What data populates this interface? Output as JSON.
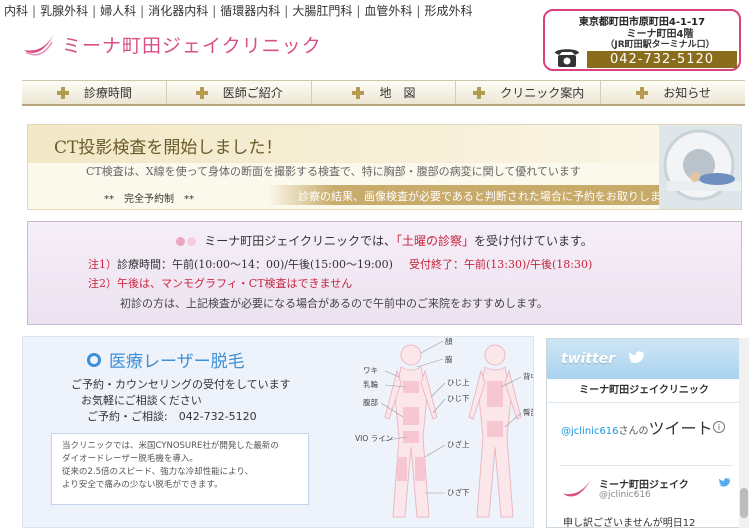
{
  "header": {
    "departments": [
      "内科",
      "乳腺外科",
      "婦人科",
      "消化器内科",
      "循環器内科",
      "大腸肛門科",
      "血管外科",
      "形成外科"
    ],
    "clinic_name": "ミーナ町田ジェイクリニック",
    "address_line1": "東京都町田市原町田4-1-17",
    "address_line2": "ミーナ町田4階",
    "address_line3": "（JR町田駅ターミナル口）",
    "phone": "042-732-5120"
  },
  "nav": {
    "items": [
      {
        "label": "診療時間"
      },
      {
        "label": "医師ご紹介"
      },
      {
        "label": "地　図"
      },
      {
        "label": "クリニック案内"
      },
      {
        "label": "お知らせ"
      }
    ]
  },
  "ct_banner": {
    "headline": "CT投影検査を開始しました！",
    "description": "CT検査は、X線を使って身体の断面を撮影する検査で、特に胸部・腹部の病変に関して優れています",
    "reservation": "**　完全予約制　**",
    "note": "診察の結果、画像検査が必要であると判断された場合に予約をお取りします"
  },
  "saturday": {
    "title_pre": "ミーナ町田ジェイクリニックでは、",
    "title_highlight": "「土曜の診察」",
    "title_post": "を受け付けています。",
    "note1_label": "注1）",
    "note1_text": "診療時間：午前(10:00〜14：00)/午後(15:00〜19:00)",
    "note1_end": "受付終了：午前(13:30)/午後(18:30)",
    "note2_label": "注2）",
    "note2_text": "午後は、マンモグラフィ・CT検査はできません",
    "note3": "初診の方は、上記検査が必要になる場合があるので午前中のご来院をおすすめします。",
    "dot_colors": [
      "#e8a8c0",
      "#f3cdd9"
    ]
  },
  "laser": {
    "title": "医療レーザー脱毛",
    "line1": "ご予約・カウンセリングの受付をしています",
    "line2": "お気軽にご相談ください",
    "line3": "ご予約・ご相談:　042-732-5120",
    "info1": "当クリニックでは、米国CYNOSURE社が開発した最新の",
    "info2": "ダイオードレーザー脱毛機を導入。",
    "info3": "従来の2.5倍のスピード、強力な冷却性能により、",
    "info4": "より安全で痛みの少ない脱毛ができます。",
    "body_labels": [
      "顔",
      "脇",
      "ワキ",
      "乳輪",
      "腹部",
      "VIO ライン",
      "ひじ上",
      "ひじ下",
      "背中",
      "臀部",
      "ひざ上",
      "ひざ下"
    ]
  },
  "twitter": {
    "brand": "twitter",
    "name": "ミーナ町田ジェイクリニック",
    "handle_prefix": "@jclinic616",
    "handle_suffix": "さんの",
    "tweets_label": "ツイート",
    "card_name": "ミーナ町田ジェイク",
    "card_handle": "@jclinic616",
    "card_message": "申し訳ございませんが明日12"
  }
}
